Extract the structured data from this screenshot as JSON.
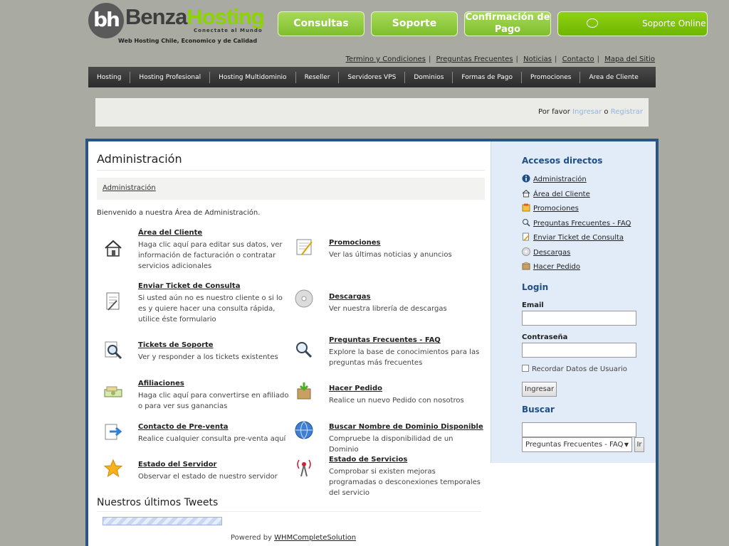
{
  "header": {
    "logo_mark": "bh",
    "logo_benza": "Benza",
    "logo_hosting": "Hosting",
    "logo_tagline": "Conectate al Mundo",
    "logo_subtitle": "Web Hosting Chile, Economico y de Calidad",
    "buttons": {
      "consultas": "Consultas",
      "soporte": "Soporte",
      "confirmacion": "Confirmación de Pago",
      "online": "Soporte Online"
    }
  },
  "toplinks": [
    "Termino y Condiciones",
    "Preguntas Frecuentes",
    "Noticias",
    "Contacto",
    "Mapa del Sitio"
  ],
  "nav": [
    "Hosting",
    "Hosting Profesional",
    "Hosting Multidominio",
    "Reseller",
    "Servidores VPS",
    "Dominios",
    "Formas de Pago",
    "Promociones",
    "Area de Cliente"
  ],
  "loginbar": {
    "prefix": "Por favor",
    "ingresar": "Ingresar",
    "o": "o",
    "registrar": "Registrar"
  },
  "main": {
    "title": "Administración",
    "breadcrumb": "Administración",
    "welcome": "Bienvenido a nuestra Área de Administración.",
    "tiles": [
      {
        "title": "Área del Cliente",
        "desc": "Haga clic aquí para editar sus datos, ver información de facturación o contratar servicios adicionales",
        "icon": "home-icon"
      },
      {
        "title": "Promociones",
        "desc": "Ver las últimas noticias y anuncios",
        "icon": "notepad-icon"
      },
      {
        "title": "Enviar Ticket de Consulta",
        "desc": "Si usted aún no es nuestro cliente o si lo es y quiere hacer una consulta rápida, utilice éste formulario",
        "icon": "ticket-edit-icon"
      },
      {
        "title": "Descargas",
        "desc": "Ver nuestra librería de descargas",
        "icon": "disc-icon"
      },
      {
        "title": "Tickets de Soporte",
        "desc": "Ver y responder a los tickets existentes",
        "icon": "search-doc-icon"
      },
      {
        "title": "Preguntas Frecuentes - FAQ",
        "desc": "Explore la base de conocimientos para las preguntas más frecuentes",
        "icon": "magnifier-icon"
      },
      {
        "title": "Afiliaciones",
        "desc": "Haga clic aquí para convertirse en afiliado o para ver sus ganancias",
        "icon": "money-icon"
      },
      {
        "title": "Hacer Pedido",
        "desc": "Realice un nuevo Pedido con nosotros",
        "icon": "package-icon"
      },
      {
        "title": "Contacto de Pre-venta",
        "desc": "Realice cualquier consulta pre-venta aquí",
        "icon": "arrow-doc-icon"
      },
      {
        "title": "Buscar Nombre de Dominio Disponible",
        "desc": "Compruebe la disponibilidad de un Dominio",
        "icon": "globe-icon"
      },
      {
        "title": "Estado del Servidor",
        "desc": "Observar el estado de nuestro servidor",
        "icon": "star-icon"
      },
      {
        "title": "Estado de Servicios",
        "desc": "Comprobar si existen mejoras programadas o desconexiones temporales del servicio",
        "icon": "antenna-icon"
      }
    ],
    "tweets_title": "Nuestros últimos Tweets",
    "powered_prefix": "Powered by",
    "powered_link": "WHMCompleteSolution"
  },
  "sidebar": {
    "accesos_title": "Accesos directos",
    "links": [
      "Administración",
      "Área del Cliente",
      "Promociones",
      "Preguntas Frecuentes - FAQ",
      "Enviar Ticket de Consulta",
      "Descargas",
      "Hacer Pedido"
    ],
    "login_title": "Login",
    "email_label": "Email",
    "password_label": "Contraseña",
    "remember_label": "Recordar Datos de Usuario",
    "login_button": "Ingresar",
    "search_title": "Buscar",
    "search_select": "Preguntas Frecuentes - FAQ",
    "search_button": "Ir"
  },
  "colors": {
    "accent_green": "#8bd400",
    "navy": "#2b5383",
    "sidebar_bg": "#e2ebf8"
  }
}
